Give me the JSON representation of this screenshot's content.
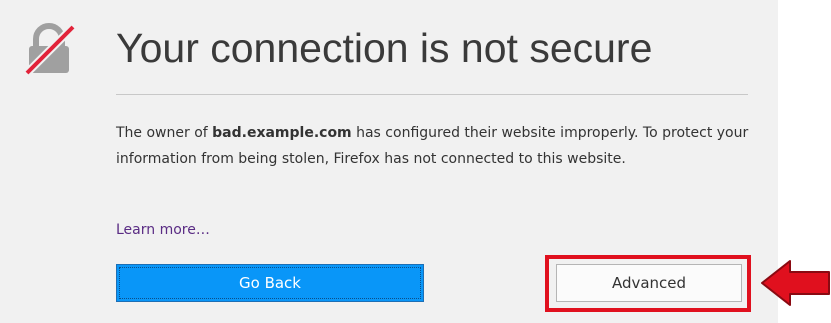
{
  "page": {
    "title": "Your connection is not secure",
    "description": {
      "before": "The owner of ",
      "domain": "bad.example.com",
      "after": " has configured their website improperly. To protect your information from being stolen, Firefox has not connected to this website."
    },
    "learn_more": "Learn more…"
  },
  "buttons": {
    "go_back": "Go Back",
    "advanced": "Advanced"
  },
  "icons": {
    "lock": "broken-lock-icon",
    "arrow": "red-left-arrow-icon"
  },
  "colors": {
    "background": "#f1f1f1",
    "title_text": "#3a3a3a",
    "link": "#5a2c84",
    "primary_button": "#0996f8",
    "annotation_red": "#e0101e",
    "lock_gray": "#a0a0a0",
    "lock_slash": "#e2233a"
  }
}
